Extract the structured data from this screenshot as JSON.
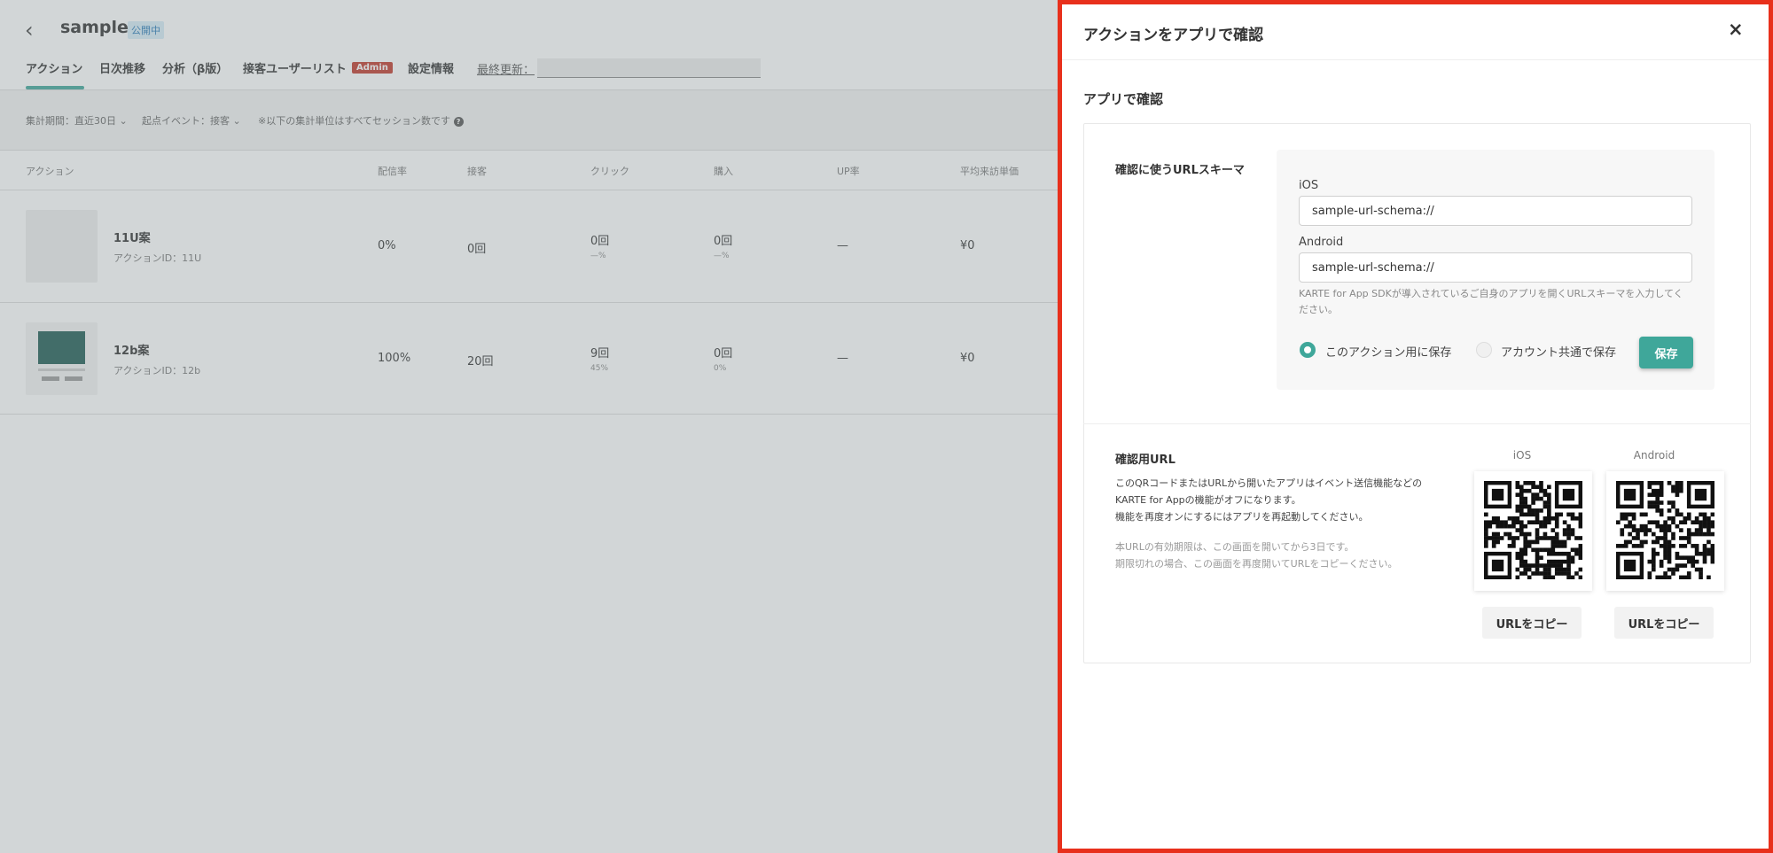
{
  "header": {
    "title": "sample",
    "status_badge": "公開中",
    "tabs": [
      "アクション",
      "日次推移",
      "分析（β版）",
      "接客ユーザーリスト",
      "設定情報"
    ],
    "admin_badge": "Admin",
    "last_updated_label": "最終更新："
  },
  "filters": {
    "period": "集計期間：直近30日",
    "event": "起点イベント：接客",
    "note": "※以下の集計単位はすべてセッション数です"
  },
  "table": {
    "columns": [
      "アクション",
      "配信率",
      "接客",
      "クリック",
      "購入",
      "UP率",
      "平均来訪単価"
    ],
    "rows": [
      {
        "name": "11U案",
        "id": "アクションID：11U",
        "rate": "0%",
        "serve": "0回",
        "click": "0回",
        "click_pct": "—%",
        "buy": "0回",
        "buy_pct": "—%",
        "up": "—",
        "avg": "¥0"
      },
      {
        "name": "12b案",
        "id": "アクションID：12b",
        "rate": "100%",
        "serve": "20回",
        "click": "9回",
        "click_pct": "45%",
        "buy": "0回",
        "buy_pct": "0%",
        "up": "—",
        "avg": "¥0"
      }
    ]
  },
  "panel": {
    "title": "アクションをアプリで確認",
    "close": "×",
    "section": "アプリで確認",
    "schema_label": "確認に使うURLスキーマ",
    "ios_label": "iOS",
    "ios_value": "sample-url-schema://",
    "android_label": "Android",
    "android_value": "sample-url-schema://",
    "hint": "KARTE for App SDKが導入されているご自身のアプリを開くURLスキーマを入力してください。",
    "radio_action": "このアクション用に保存",
    "radio_account": "アカウント共通で保存",
    "save": "保存",
    "confirm_label": "確認用URL",
    "desc1": "このQRコードまたはURLから開いたアプリはイベント送信機能などのKARTE for Appの機能がオフになります。",
    "desc2": "機能を再度オンにするにはアプリを再起動してください。",
    "desc3": "本URLの有効期限は、この画面を開いてから3日です。",
    "desc4": "期限切れの場合、この画面を再度開いてURLをコピーください。",
    "qr_ios": "iOS",
    "qr_android": "Android",
    "copy_label": "URLをコピー"
  },
  "colors": {
    "accent": "#3fa79a",
    "highlight_border": "#e8301c",
    "admin": "#c0392b"
  },
  "icons": [
    "back-icon",
    "chevron-down-icon",
    "help-icon",
    "close-icon",
    "qr-code-icon"
  ]
}
